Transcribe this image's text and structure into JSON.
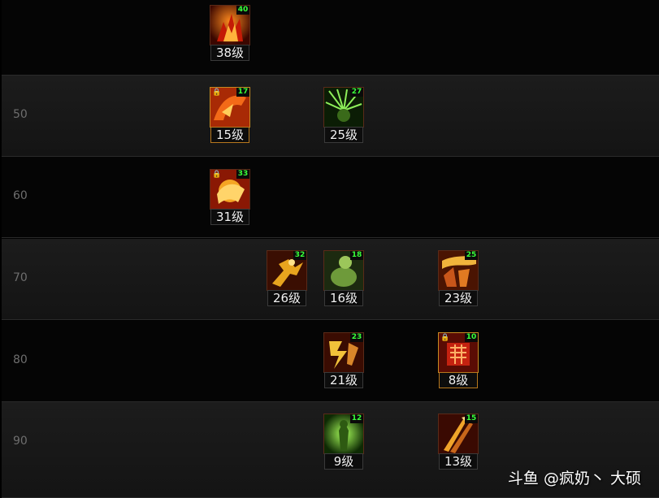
{
  "rows": [
    {
      "label": ""
    },
    {
      "label": "50"
    },
    {
      "label": "60"
    },
    {
      "label": "70"
    },
    {
      "label": "80"
    },
    {
      "label": "90"
    }
  ],
  "skills": [
    {
      "name": "flame-burst",
      "level": "38级",
      "req": "40",
      "locked": false,
      "badge": "clock",
      "gold": false
    },
    {
      "name": "dragon-strike",
      "level": "15级",
      "req": "17",
      "locked": true,
      "badge": "V",
      "gold": true
    },
    {
      "name": "spike-nova",
      "level": "25级",
      "req": "27",
      "locked": false,
      "badge": "",
      "gold": false
    },
    {
      "name": "sun-fist",
      "level": "31级",
      "req": "33",
      "locked": true,
      "badge": "R",
      "gold": false
    },
    {
      "name": "golden-dash",
      "level": "26级",
      "req": "32",
      "locked": false,
      "badge": "clock",
      "gold": false
    },
    {
      "name": "stone-guard",
      "level": "16级",
      "req": "18",
      "locked": false,
      "badge": "clock",
      "gold": false
    },
    {
      "name": "heat-wave",
      "level": "23级",
      "req": "25",
      "locked": false,
      "badge": "clock",
      "gold": false
    },
    {
      "name": "blaze-kick",
      "level": "21级",
      "req": "23",
      "locked": false,
      "badge": "clock",
      "gold": false
    },
    {
      "name": "rune-seal",
      "level": "8级",
      "req": "10",
      "locked": true,
      "badge": "",
      "gold": true
    },
    {
      "name": "green-aura",
      "level": "9级",
      "req": "12",
      "locked": false,
      "badge": "",
      "gold": false
    },
    {
      "name": "spear-rain",
      "level": "13级",
      "req": "15",
      "locked": false,
      "badge": "clock",
      "gold": false
    }
  ],
  "watermark": "斗鱼 @疯奶丶 大硕",
  "colors": {
    "req_text": "#39ff39",
    "row_label": "#6e6e6e"
  }
}
